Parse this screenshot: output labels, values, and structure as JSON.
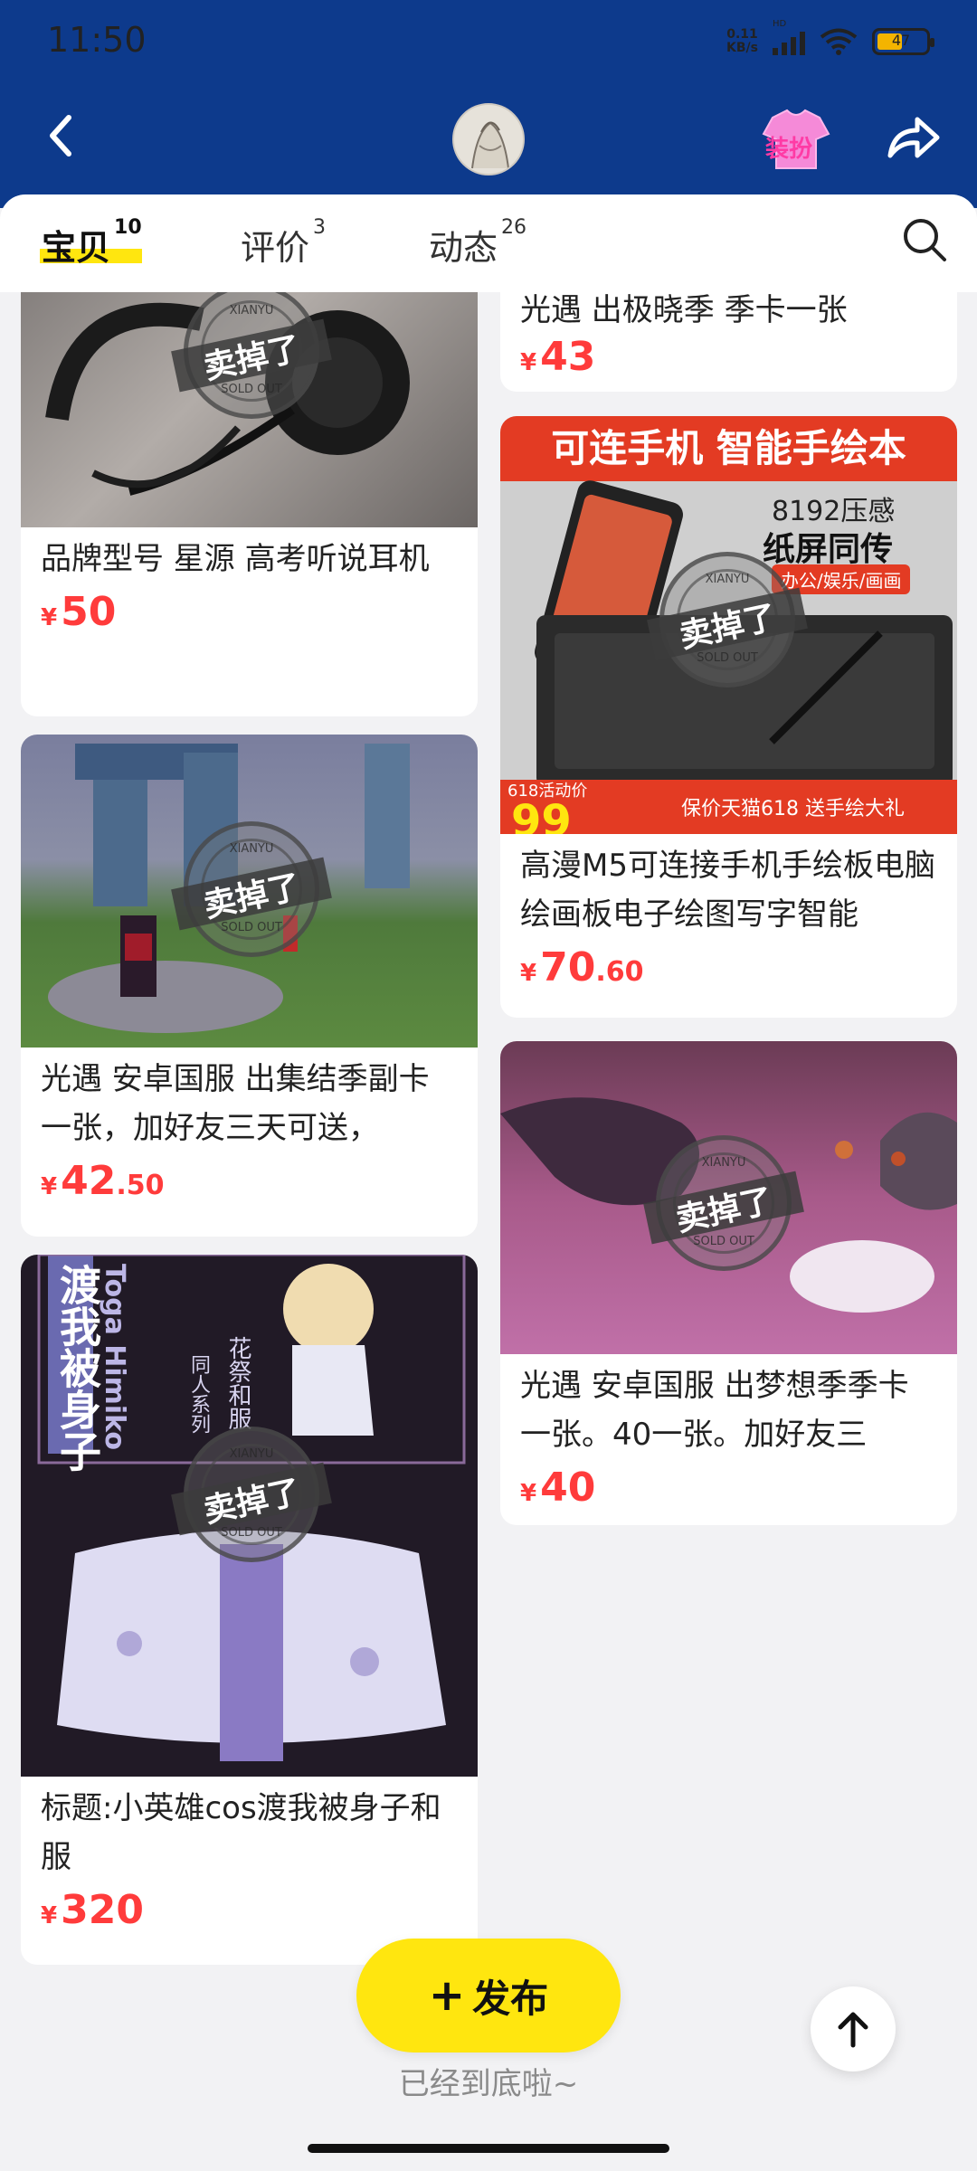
{
  "status": {
    "time": "11:50",
    "netspeed": "0.11\nKB/s",
    "network": "HD",
    "battery": "47"
  },
  "header": {
    "dressup_label": "装扮"
  },
  "tabs": [
    {
      "label": "宝贝",
      "count": "10"
    },
    {
      "label": "评价",
      "count": "3"
    },
    {
      "label": "动态",
      "count": "26"
    }
  ],
  "items": [
    {
      "title": "品牌型号 星源 高考听说耳机",
      "price_int": "50",
      "price_dec": ""
    },
    {
      "title": "光遇 出极晓季 季卡一张",
      "price_int": "43",
      "price_dec": ""
    },
    {
      "title": "高漫M5可连接手机手绘板电脑绘画板电子绘图写字智能",
      "price_int": "70",
      "price_dec": ".60",
      "img_text_top": "可连手机 智能手绘本",
      "img_text_a": "8192压感",
      "img_text_b": "纸屏同传",
      "img_text_c": "办公/娱乐/画画",
      "img_text_d": "618活动价",
      "img_text_e": "保价天猫618 送手绘大礼",
      "img_text_f": "99"
    },
    {
      "title": "光遇 安卓国服 出集结季副卡一张，加好友三天可送，",
      "price_int": "42",
      "price_dec": ".50"
    },
    {
      "title": "光遇 安卓国服 出梦想季季卡一张。40一张。加好友三",
      "price_int": "40",
      "price_dec": ""
    },
    {
      "title": "标题:小英雄cos渡我被身子和服",
      "price_int": "320",
      "price_dec": "",
      "img_text_a": "渡我被身子",
      "img_text_b": "Toga Himiko",
      "img_text_c": "花祭和服",
      "img_text_d": "同人系列"
    }
  ],
  "sold_stamp": {
    "main": "卖掉了",
    "top": "XIANYU",
    "bottom": "SOLD OUT"
  },
  "currency": "¥",
  "publish_label": "发布",
  "footer": "已经到底啦~",
  "colors": {
    "header_bg": "#0d3a8c",
    "accent_yellow": "#ffe60f",
    "price_red": "#ff3b3b"
  }
}
